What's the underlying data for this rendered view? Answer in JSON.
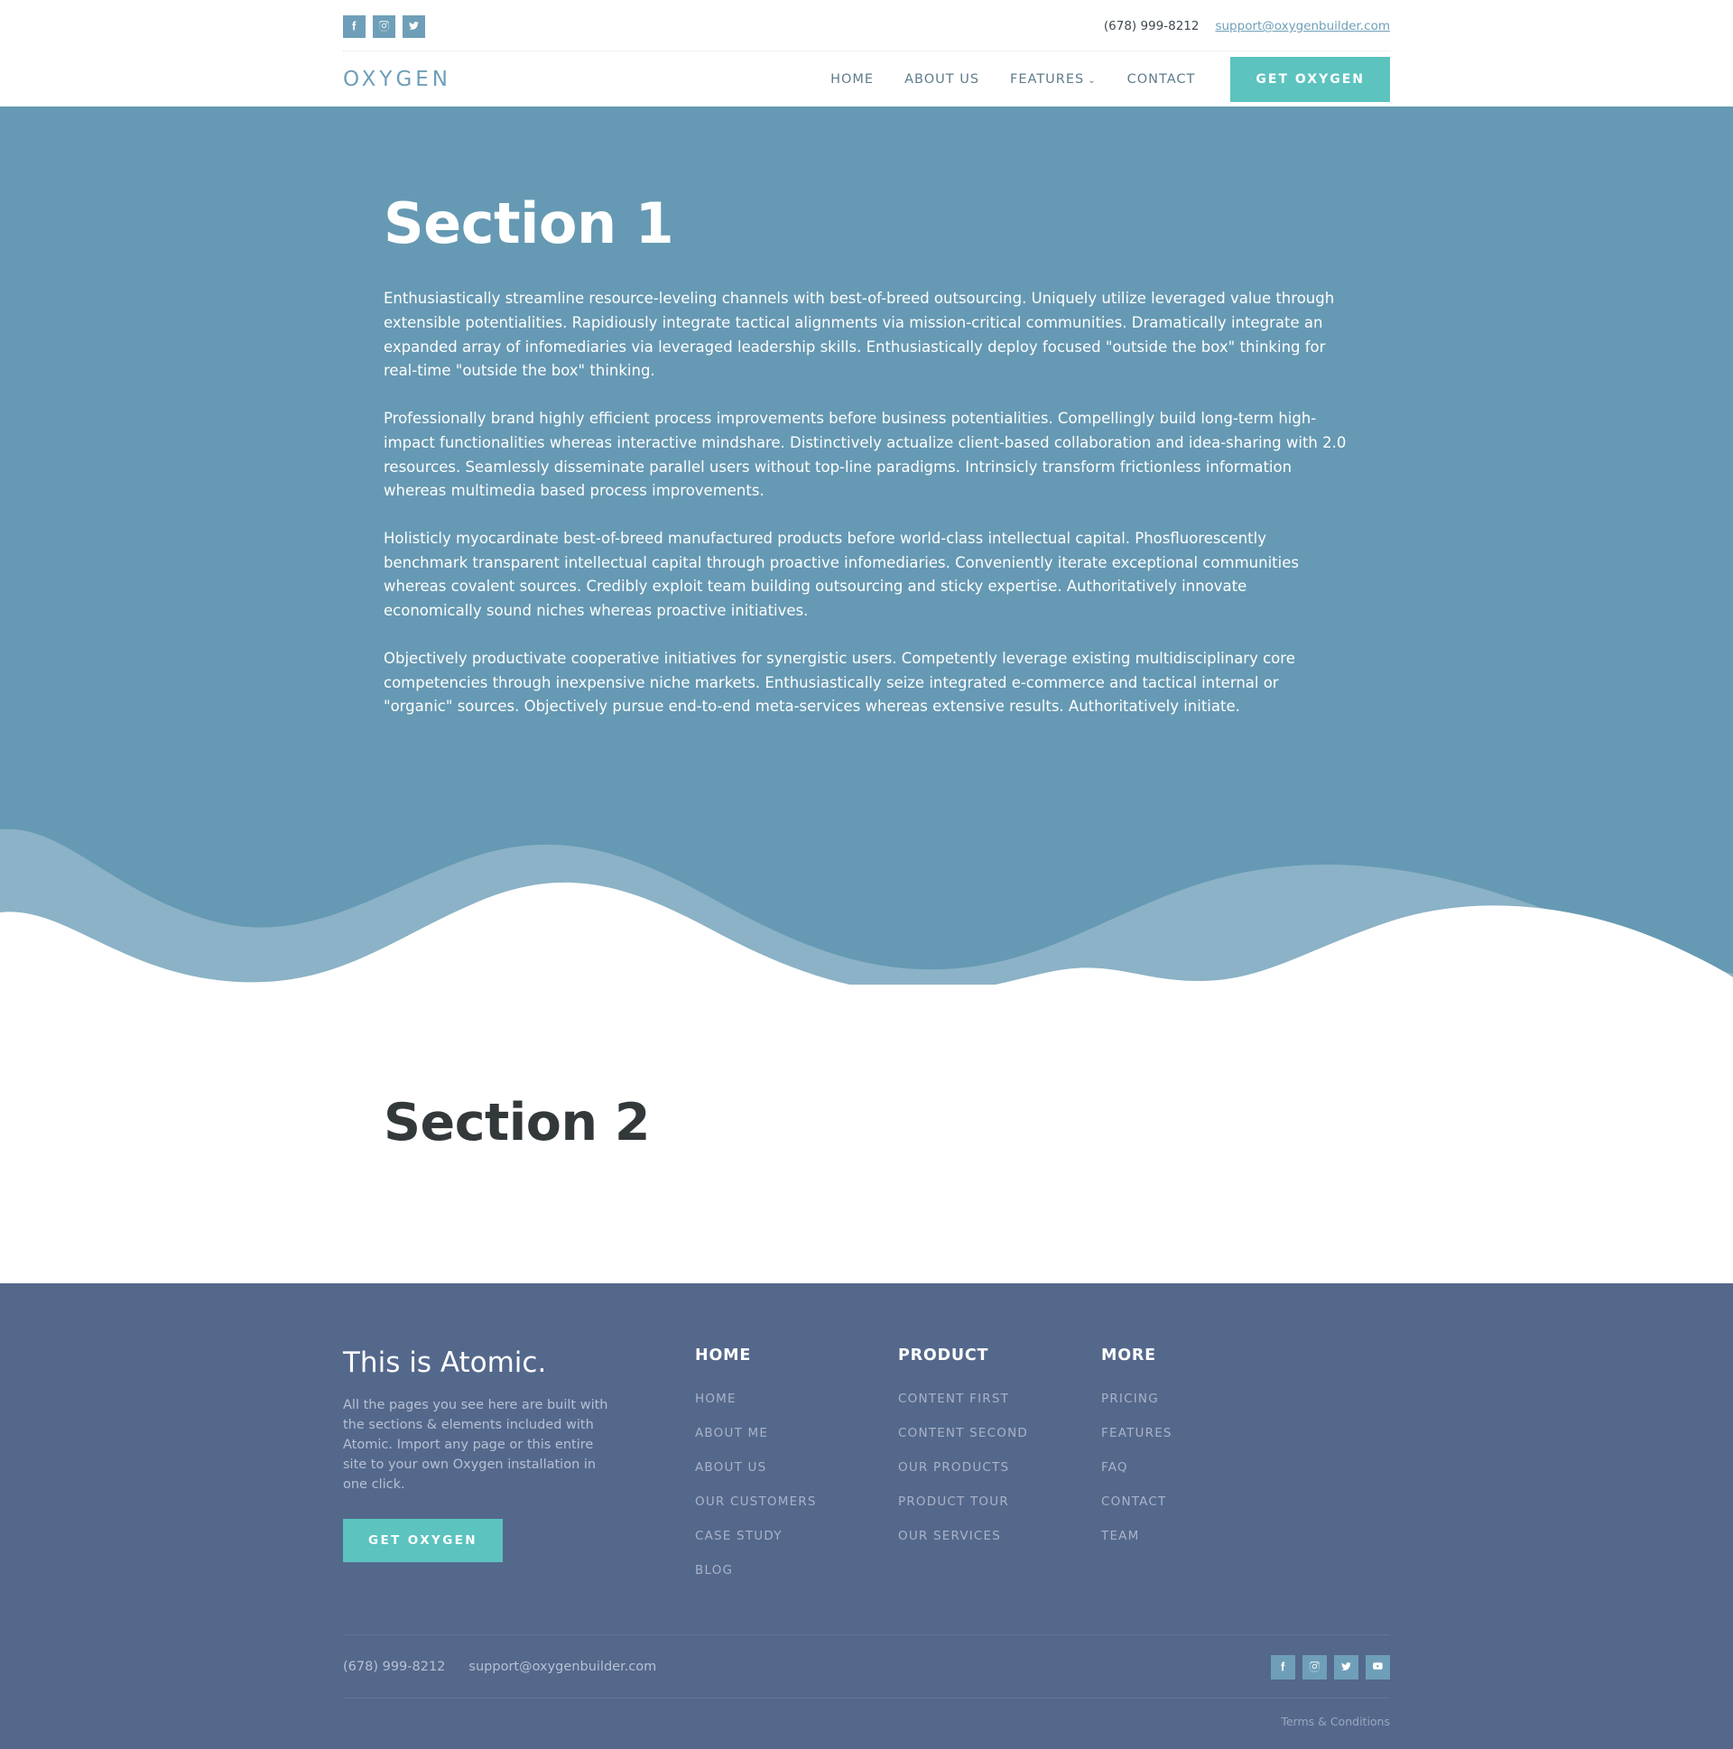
{
  "topbar": {
    "social": [
      {
        "name": "facebook-icon",
        "label": "Facebook"
      },
      {
        "name": "instagram-icon",
        "label": "Instagram"
      },
      {
        "name": "twitter-icon",
        "label": "Twitter"
      }
    ],
    "phone": "(678) 999-8212",
    "email": "support@oxygenbuilder.com"
  },
  "nav": {
    "logo": "OXYGEN",
    "links": [
      {
        "label": "HOME",
        "caret": ""
      },
      {
        "label": "ABOUT US",
        "caret": ""
      },
      {
        "label": "FEATURES",
        "caret": "⌄"
      },
      {
        "label": "CONTACT",
        "caret": ""
      }
    ],
    "cta": "GET OXYGEN"
  },
  "hero": {
    "heading": "Section 1",
    "paragraphs": [
      "Enthusiastically streamline resource-leveling channels with best-of-breed outsourcing. Uniquely utilize leveraged value through extensible potentialities. Rapidiously integrate tactical alignments via mission-critical communities. Dramatically integrate an expanded array of infomediaries via leveraged leadership skills. Enthusiastically deploy focused \"outside the box\" thinking for real-time \"outside the box\" thinking.",
      "Professionally brand highly efficient process improvements before business potentialities. Compellingly build long-term high-impact functionalities whereas interactive mindshare. Distinctively actualize client-based collaboration and idea-sharing with 2.0 resources. Seamlessly disseminate parallel users without top-line paradigms. Intrinsicly transform frictionless information whereas multimedia based process improvements.",
      "Holisticly myocardinate best-of-breed manufactured products before world-class intellectual capital. Phosfluorescently benchmark transparent intellectual capital through proactive infomediaries. Conveniently iterate exceptional communities whereas covalent sources. Credibly exploit team building outsourcing and sticky expertise. Authoritatively innovate economically sound niches whereas proactive initiatives.",
      "Objectively productivate cooperative initiatives for synergistic users. Competently leverage existing multidisciplinary core competencies through inexpensive niche markets. Enthusiastically seize integrated e-commerce and tactical internal or \"organic\" sources. Objectively pursue end-to-end meta-services whereas extensive results. Authoritatively initiate."
    ]
  },
  "section2": {
    "heading": "Section 2"
  },
  "footer": {
    "brand_title": "This is Atomic.",
    "brand_text": "All the pages you see here are built with the sections & elements included with Atomic. Import any page or this entire site to your own Oxygen installation in one click.",
    "brand_cta": "GET OXYGEN",
    "columns": [
      {
        "title": "HOME",
        "links": [
          "HOME",
          "ABOUT ME",
          "ABOUT US",
          "OUR CUSTOMERS",
          "CASE STUDY",
          "BLOG"
        ]
      },
      {
        "title": "PRODUCT",
        "links": [
          "CONTENT FIRST",
          "CONTENT SECOND",
          "OUR PRODUCTS",
          "PRODUCT TOUR",
          "OUR SERVICES"
        ]
      },
      {
        "title": "MORE",
        "links": [
          "PRICING",
          "FEATURES",
          "FAQ",
          "CONTACT",
          "TEAM"
        ]
      }
    ],
    "phone": "(678) 999-8212",
    "email": "support@oxygenbuilder.com",
    "social": [
      {
        "name": "facebook-icon",
        "label": "Facebook"
      },
      {
        "name": "instagram-icon",
        "label": "Instagram"
      },
      {
        "name": "twitter-icon",
        "label": "Twitter"
      },
      {
        "name": "youtube-icon",
        "label": "YouTube"
      }
    ],
    "legal": "Terms & Conditions"
  },
  "colors": {
    "hero_blue": "#6699b3",
    "wave_light": "#8bb2c6",
    "footer_blue": "#54688c",
    "teal": "#5cc3bf",
    "social_blue": "#6f9fb8",
    "nav_text": "#5f7c8c",
    "dark_heading": "#33383b"
  }
}
